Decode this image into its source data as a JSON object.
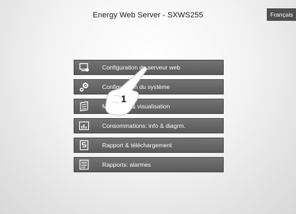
{
  "header": {
    "title": "Energy Web Server - SXWS255",
    "language_label": "Français"
  },
  "menu": {
    "items": [
      {
        "label": "Configuration du serveur web",
        "icon": "server-config-icon"
      },
      {
        "label": "Configuration du système",
        "icon": "system-config-icon"
      },
      {
        "label": "Monitoring & visualisation",
        "icon": "monitoring-icon"
      },
      {
        "label": "Consommations: info & diagrm.",
        "icon": "bar-chart-icon"
      },
      {
        "label": "Rapport & téléchargement",
        "icon": "report-download-icon"
      },
      {
        "label": "Rapports: alarmes",
        "icon": "alarm-report-icon"
      }
    ]
  },
  "annotation": {
    "step_number": "1",
    "pointer_icon": "pointing-hand-icon"
  },
  "colors": {
    "menu_background": "#626262",
    "language_button": "#4f4f4f",
    "text_light": "#ffffff"
  }
}
